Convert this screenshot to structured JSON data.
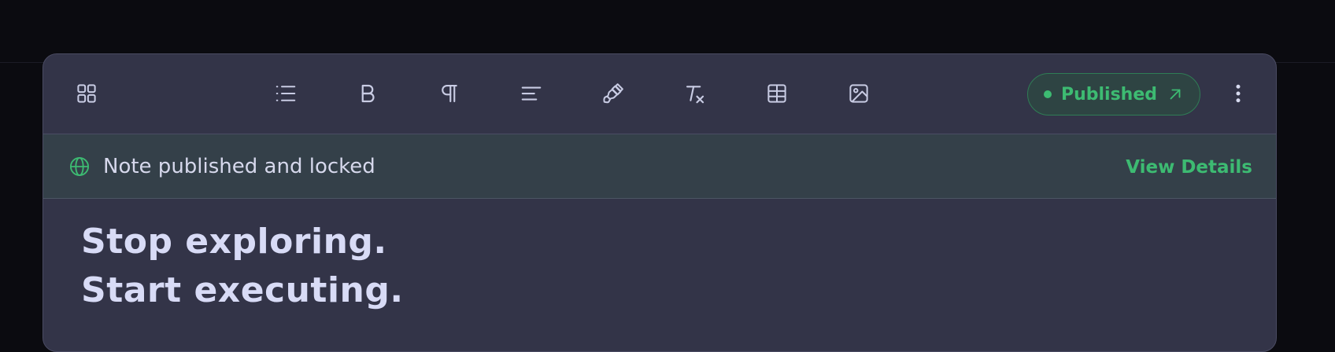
{
  "toolbar": {
    "icons": [
      "grid-icon",
      "list-icon",
      "bold-icon",
      "paragraph-icon",
      "align-left-icon",
      "paintbrush-icon",
      "clear-format-icon",
      "table-icon",
      "image-icon"
    ],
    "status_label": "Published",
    "status_color": "#3dbb72"
  },
  "banner": {
    "message": "Note published and locked",
    "link_label": "View Details",
    "icon": "globe-icon"
  },
  "content": {
    "heading_line1": "Stop exploring.",
    "heading_line2": "Start executing."
  },
  "colors": {
    "background": "#0b0b10",
    "panel": "#333448",
    "banner": "#344049",
    "accent": "#3dbb72",
    "icon": "#c9cce4",
    "heading": "#d8dbf6"
  }
}
